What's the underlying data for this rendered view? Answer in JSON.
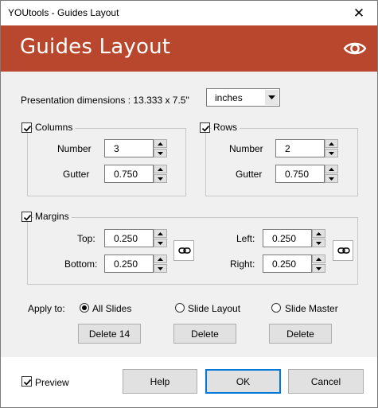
{
  "window": {
    "title": "YOUtools - Guides Layout",
    "close_glyph": "✕"
  },
  "header": {
    "title": "Guides Layout",
    "icon": "eye-icon",
    "bg_color": "#b8472d"
  },
  "dimensions": {
    "label": "Presentation dimensions : 13.333 x 7.5\"",
    "unit_value": "inches"
  },
  "columns": {
    "label": "Columns",
    "checked": true,
    "number_label": "Number",
    "number_value": "3",
    "gutter_label": "Gutter",
    "gutter_value": "0.750"
  },
  "rows": {
    "label": "Rows",
    "checked": true,
    "number_label": "Number",
    "number_value": "2",
    "gutter_label": "Gutter",
    "gutter_value": "0.750"
  },
  "margins": {
    "label": "Margins",
    "checked": true,
    "top_label": "Top:",
    "top_value": "0.250",
    "bottom_label": "Bottom:",
    "bottom_value": "0.250",
    "left_label": "Left:",
    "left_value": "0.250",
    "right_label": "Right:",
    "right_value": "0.250"
  },
  "apply": {
    "label": "Apply to:",
    "options": [
      {
        "label": "All Slides",
        "selected": true,
        "delete_label": "Delete 14"
      },
      {
        "label": "Slide Layout",
        "selected": false,
        "delete_label": "Delete"
      },
      {
        "label": "Slide Master",
        "selected": false,
        "delete_label": "Delete"
      }
    ]
  },
  "footer": {
    "preview_label": "Preview",
    "preview_checked": true,
    "help_label": "Help",
    "ok_label": "OK",
    "cancel_label": "Cancel"
  }
}
